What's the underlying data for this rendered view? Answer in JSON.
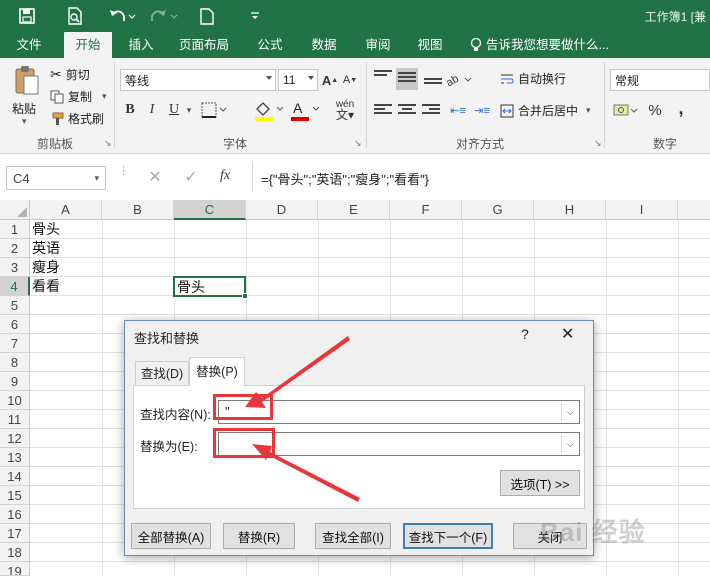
{
  "titlebar": {
    "doc_title": "工作簿1 [兼",
    "qa_icons": [
      "save-icon",
      "print-preview-icon",
      "undo-icon",
      "redo-icon",
      "new-document-icon",
      "customize-icon"
    ]
  },
  "tabs": [
    "文件",
    "开始",
    "插入",
    "页面布局",
    "公式",
    "数据",
    "审阅",
    "视图"
  ],
  "active_tab": "开始",
  "tell_me": "告诉我您想要做什么...",
  "clipboard": {
    "paste": "粘贴",
    "cut": "剪切",
    "copy": "复制",
    "format_painter": "格式刷",
    "label": "剪贴板"
  },
  "font": {
    "name": "等线",
    "size": "11",
    "bold": "B",
    "italic": "I",
    "underline": "U",
    "grow": "A",
    "shrink": "A",
    "phonetic": "wén",
    "label": "字体"
  },
  "alignment": {
    "wrap": "自动换行",
    "merge": "合并后居中",
    "label": "对齐方式"
  },
  "number": {
    "format": "常规",
    "percent": "%",
    "comma": ",",
    "label": "数字"
  },
  "formula_bar": {
    "name_box": "C4",
    "fx": "fx",
    "formula": "={\"骨头\";\"英语\";\"瘦身\";\"看看\"}"
  },
  "columns": [
    "A",
    "B",
    "C",
    "D",
    "E",
    "F",
    "G",
    "H",
    "I"
  ],
  "rows": [
    "1",
    "2",
    "3",
    "4",
    "5",
    "6",
    "7",
    "8",
    "9",
    "10",
    "11",
    "12",
    "13",
    "14",
    "15",
    "16",
    "17",
    "18",
    "19"
  ],
  "cells": {
    "A1": "骨头",
    "A2": "英语",
    "A3": "瘦身",
    "A4": "看看",
    "C4": "骨头"
  },
  "dialog": {
    "title": "查找和替换",
    "help": "?",
    "close": "✕",
    "tab_find": "查找(D)",
    "tab_replace": "替换(P)",
    "find_label": "查找内容(N):",
    "find_value": "\"",
    "replace_label": "替换为(E):",
    "replace_value": "",
    "options": "选项(T) >>",
    "replace_all": "全部替换(A)",
    "replace": "替换(R)",
    "find_all": "查找全部(I)",
    "find_next": "查找下一个(F)",
    "close_btn": "关闭"
  },
  "watermark": "Bai 经验",
  "colors": {
    "excel_green": "#217346",
    "arrow_red": "#e8373a",
    "selection_green": "#217346"
  }
}
